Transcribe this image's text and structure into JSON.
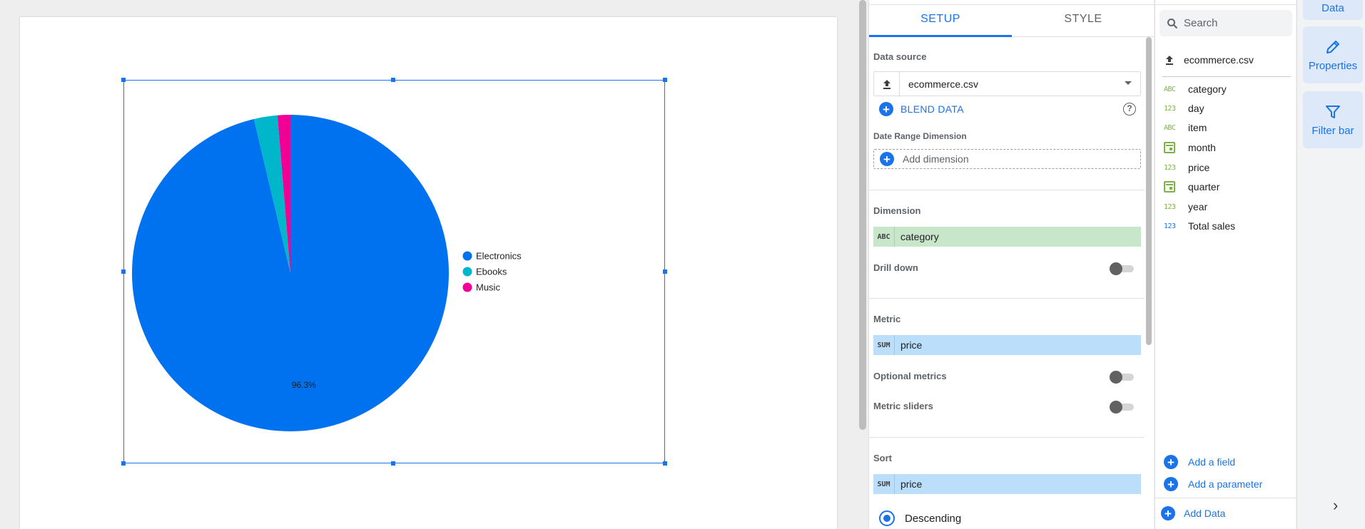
{
  "chart_data": {
    "type": "pie",
    "categories": [
      "Electronics",
      "Ebooks",
      "Music"
    ],
    "values": [
      96.3,
      2.4,
      1.3
    ],
    "colors": [
      "#0072f0",
      "#00b6cb",
      "#f10096"
    ],
    "data_labels": [
      "96.3%",
      "",
      ""
    ],
    "legend_position": "right"
  },
  "setup": {
    "tabs": [
      "SETUP",
      "STYLE"
    ],
    "data_source_label": "Data source",
    "data_source_name": "ecommerce.csv",
    "blend_label": "BLEND DATA",
    "help_icon_text": "?",
    "date_range_label": "Date Range Dimension",
    "add_dimension_label": "Add dimension",
    "dimension_label": "Dimension",
    "dimension_tag": "ABC",
    "dimension_field": "category",
    "drill_down_label": "Drill down",
    "metric_label": "Metric",
    "metric_tag": "SUM",
    "metric_field": "price",
    "optional_metrics_label": "Optional metrics",
    "metric_sliders_label": "Metric sliders",
    "sort_label": "Sort",
    "sort_tag": "SUM",
    "sort_field": "price",
    "sort_order": "Descending"
  },
  "fields": {
    "search_placeholder": "Search",
    "source_name": "ecommerce.csv",
    "items": [
      {
        "type": "ABC",
        "name": "category"
      },
      {
        "type": "123",
        "name": "day"
      },
      {
        "type": "ABC",
        "name": "item"
      },
      {
        "type": "calendar",
        "name": "month"
      },
      {
        "type": "123",
        "name": "price"
      },
      {
        "type": "calendar",
        "name": "quarter"
      },
      {
        "type": "123",
        "name": "year"
      },
      {
        "type": "123",
        "name": "Total sales"
      }
    ],
    "add_field_label": "Add a field",
    "add_parameter_label": "Add a parameter",
    "add_data_label": "Add Data"
  },
  "rail": {
    "data_label": "Data",
    "properties_label": "Properties",
    "filter_bar_label": "Filter bar"
  }
}
